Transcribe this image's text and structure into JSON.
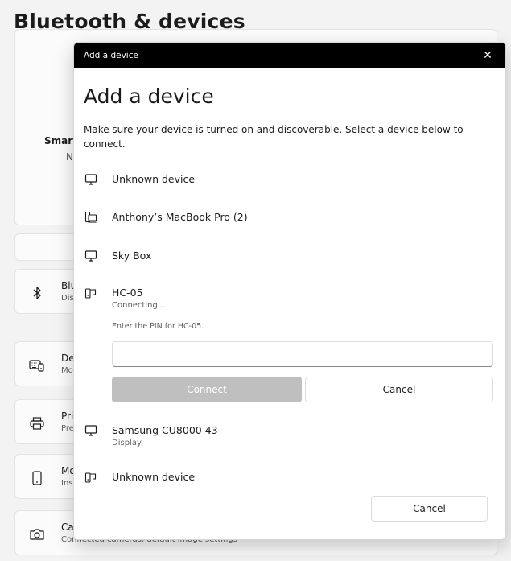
{
  "page": {
    "title": "Bluetooth & devices",
    "hero": {
      "name": "Smart",
      "sub": "N"
    },
    "rows": [
      {
        "icon": "bluetooth-icon",
        "title": "Blu",
        "sub": "Dis"
      },
      {
        "icon": "keyboard-icon",
        "title": "De",
        "sub": "Mo"
      },
      {
        "icon": "printer-icon",
        "title": "Pri",
        "sub": "Pre"
      },
      {
        "icon": "phone-icon",
        "title": "Mo",
        "sub": "Ins"
      },
      {
        "icon": "camera-icon",
        "title": "Ca",
        "sub": "Connected cameras, default image settings"
      }
    ]
  },
  "dialog": {
    "window_title": "Add a device",
    "close_glyph": "✕",
    "heading": "Add a device",
    "description": "Make sure your device is turned on and discoverable. Select a device below to connect.",
    "devices": [
      {
        "icon": "monitor-icon",
        "name": "Unknown device",
        "sub": ""
      },
      {
        "icon": "laptop-phone-icon",
        "name": "Anthony’s MacBook Pro (2)",
        "sub": ""
      },
      {
        "icon": "monitor-icon",
        "name": "Sky Box",
        "sub": ""
      },
      {
        "icon": "device-audio-icon",
        "name": "HC-05",
        "sub": "Connecting..."
      },
      {
        "icon": "monitor-icon",
        "name": "Samsung CU8000 43",
        "sub": "Display"
      },
      {
        "icon": "device-audio-icon",
        "name": "Unknown device",
        "sub": ""
      }
    ],
    "pin_prompt": "Enter the PIN for HC-05.",
    "pin_value": "",
    "connect_label": "Connect",
    "cancel_inline_label": "Cancel",
    "cancel_footer_label": "Cancel"
  },
  "colors": {
    "titlebar": "#000000",
    "connect_disabled": "#bfbfbf",
    "background": "#f3f3f3"
  }
}
